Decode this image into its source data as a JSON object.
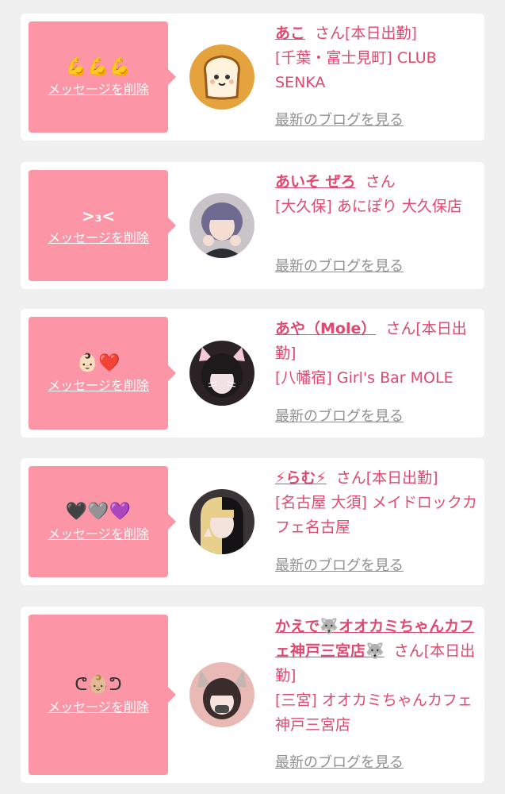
{
  "cards": [
    {
      "message": "💪💪💪",
      "delete_label": "メッセージを削除",
      "name": "あこ",
      "honorific": "さん",
      "badge": "[本日出勤]",
      "shop": "[千葉・富士見町] CLUB SENKA",
      "blog_label": "最新のブログを見る",
      "avatar": "bread-character"
    },
    {
      "message": ">₃<",
      "delete_label": "メッセージを削除",
      "name": "あいそ ぜろ",
      "honorific": "さん",
      "badge": "",
      "shop": "[大久保] あにぽり 大久保店",
      "blog_label": "最新のブログを見る",
      "avatar": "purple-hair-girl"
    },
    {
      "message": "👶🏻❤️",
      "delete_label": "メッセージを削除",
      "name": "あや（Mole）",
      "honorific": "さん",
      "badge": "[本日出勤]",
      "shop": "[八幡宿] Girl's Bar MOLE",
      "blog_label": "最新のブログを見る",
      "avatar": "cat-ears-girl"
    },
    {
      "message": "🖤🩶💜",
      "delete_label": "メッセージを削除",
      "name": "⚡らむ⚡",
      "honorific": "さん",
      "badge": "[本日出勤]",
      "shop": "[名古屋 大須] メイドロックカフェ名古屋",
      "blog_label": "最新のブログを見る",
      "avatar": "blonde-black-hair-girl"
    },
    {
      "message": "ᕦ👶🏼ᕤ",
      "delete_label": "メッセージを削除",
      "name": "かえで🐺オオカミちゃんカフェ神戸三宮店🐺",
      "honorific": "さん",
      "badge": "[本日出勤]",
      "shop": "[三宮] オオカミちゃんカフェ神戸三宮店",
      "blog_label": "最新のブログを見る",
      "avatar": "wolf-ears-girl"
    }
  ]
}
